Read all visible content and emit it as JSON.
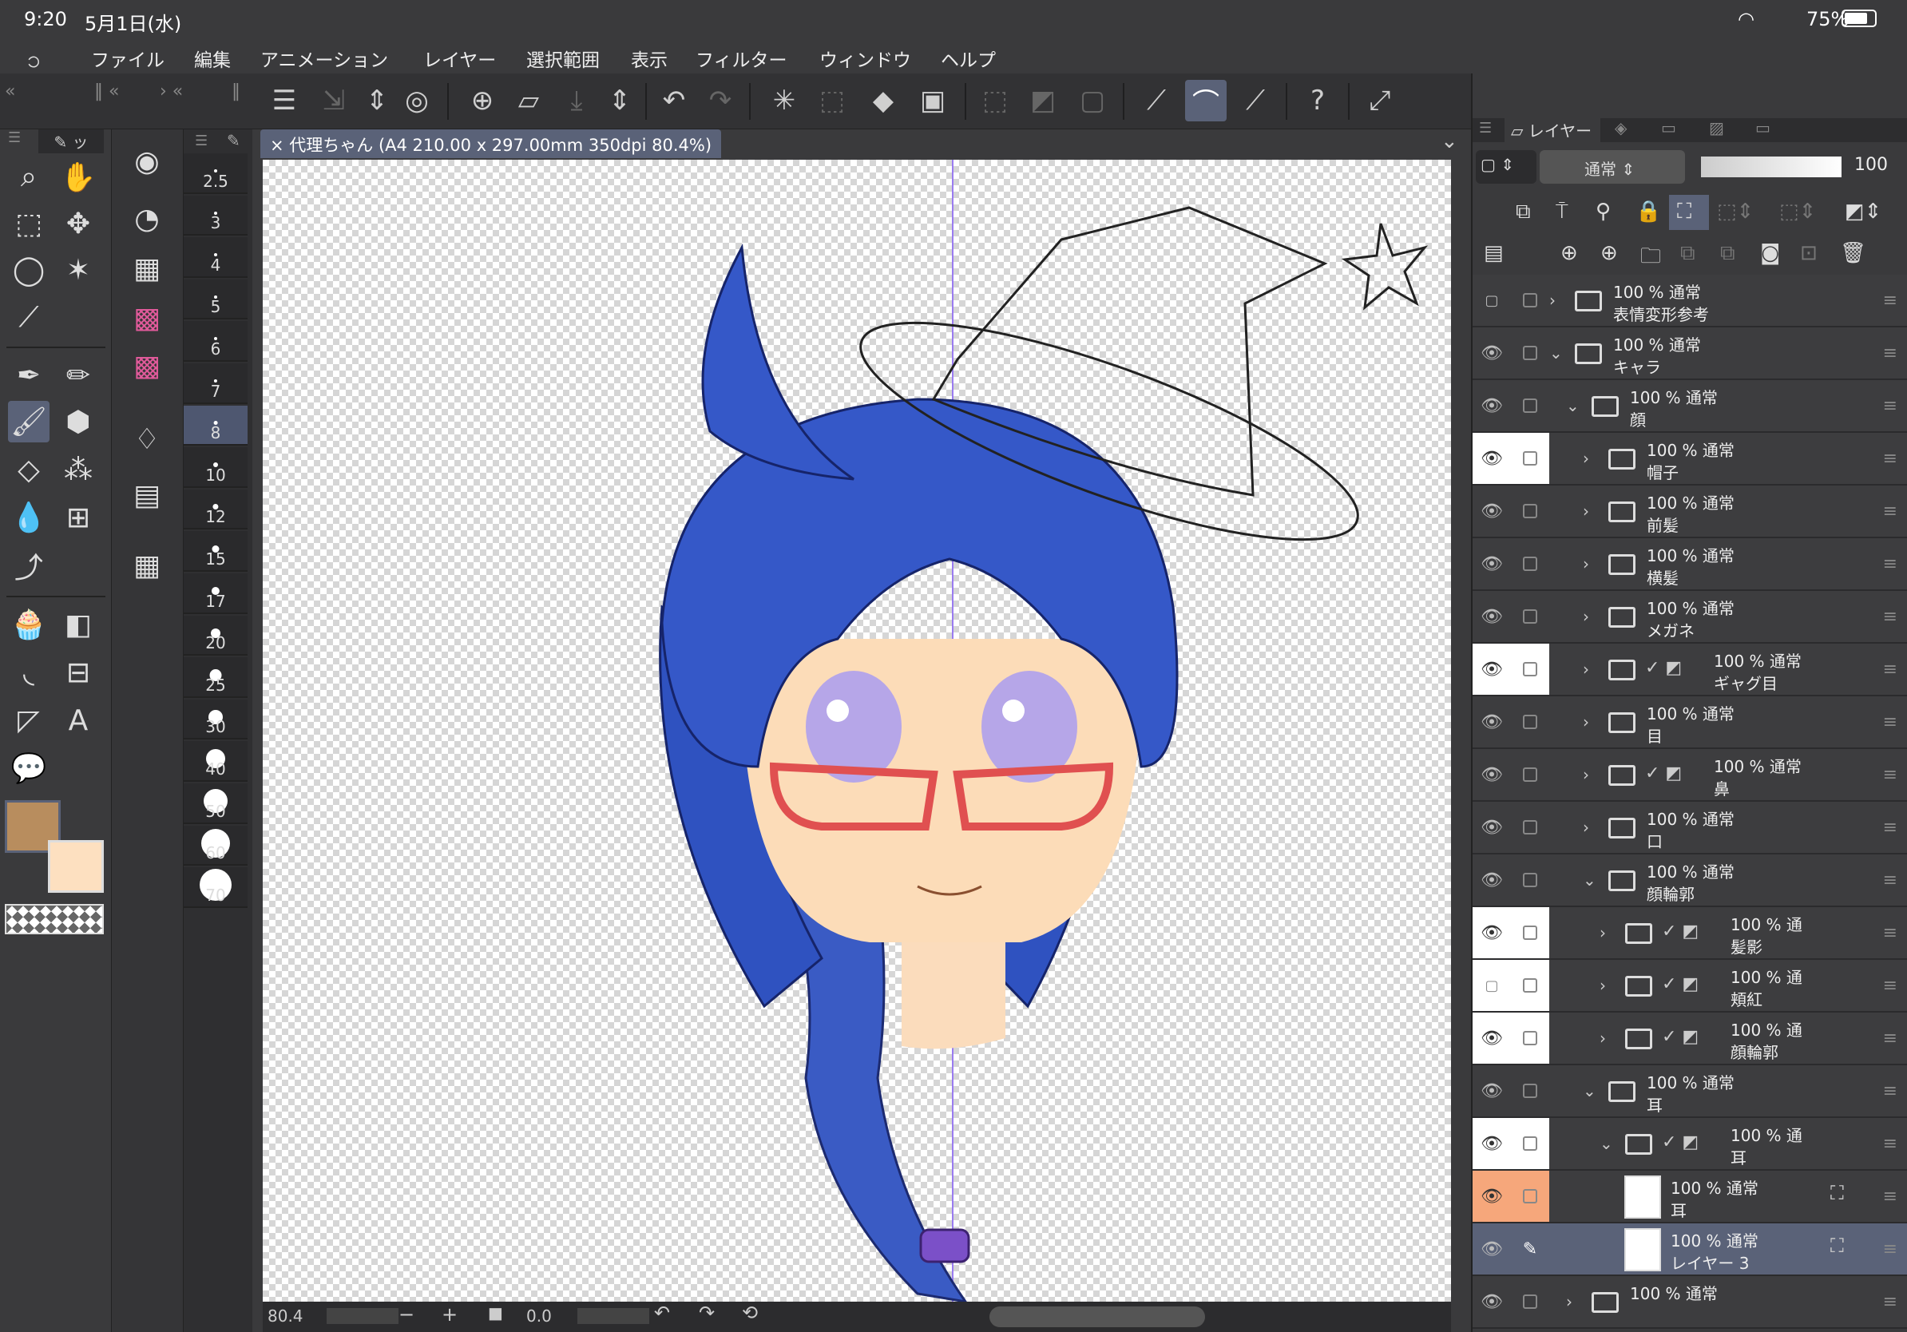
{
  "status": {
    "time": "9:20",
    "date": "5月1日(水)",
    "battery": "75%"
  },
  "menu": [
    "ファイル",
    "編集",
    "アニメーション",
    "レイヤー",
    "選択範囲",
    "表示",
    "フィルター",
    "ウィンドウ",
    "ヘルプ"
  ],
  "document": {
    "tab_label": "代理ちゃん (A4 210.00 x 297.00mm 350dpi 80.4%)"
  },
  "bottom": {
    "zoom": "80.4",
    "angle": "0.0"
  },
  "brush_sizes": [
    "2.5",
    "3",
    "4",
    "5",
    "6",
    "7",
    "8",
    "10",
    "12",
    "15",
    "17",
    "20",
    "25",
    "30",
    "40",
    "50",
    "60",
    "70"
  ],
  "brush_selected": "8",
  "colors": {
    "main": "#b88d5e",
    "sub": "#fde0c0",
    "accent": "#5a6278",
    "highlight": "#f6a77b"
  },
  "layer_panel": {
    "tab_label": "レイヤー",
    "blend_mode": "通常",
    "opacity": "100",
    "layers": [
      {
        "pct": "100 % 通常",
        "name": "表情変形参考",
        "indent": 0,
        "eye": "off",
        "open": false,
        "icon": "folder"
      },
      {
        "pct": "100 % 通常",
        "name": "キャラ",
        "indent": 0,
        "eye": "eye",
        "open": true,
        "icon": "folder"
      },
      {
        "pct": "100 % 通常",
        "name": "顔",
        "indent": 1,
        "eye": "eye",
        "open": true,
        "icon": "folder"
      },
      {
        "pct": "100 % 通常",
        "name": "帽子",
        "indent": 2,
        "eye": "on",
        "open": false,
        "icon": "folder"
      },
      {
        "pct": "100 % 通常",
        "name": "前髪",
        "indent": 2,
        "eye": "eye",
        "open": false,
        "icon": "folder"
      },
      {
        "pct": "100 % 通常",
        "name": "横髪",
        "indent": 2,
        "eye": "eye",
        "open": false,
        "icon": "folder"
      },
      {
        "pct": "100 % 通常",
        "name": "メガネ",
        "indent": 2,
        "eye": "eye",
        "open": false,
        "icon": "folder"
      },
      {
        "pct": "100 % 通常",
        "name": "ギャグ目",
        "indent": 2,
        "eye": "on",
        "open": false,
        "icon": "folder-check"
      },
      {
        "pct": "100 % 通常",
        "name": "目",
        "indent": 2,
        "eye": "eye",
        "open": false,
        "icon": "folder"
      },
      {
        "pct": "100 % 通常",
        "name": "鼻",
        "indent": 2,
        "eye": "eye",
        "open": false,
        "icon": "folder-check"
      },
      {
        "pct": "100 % 通常",
        "name": "口",
        "indent": 2,
        "eye": "eye",
        "open": false,
        "icon": "folder"
      },
      {
        "pct": "100 % 通常",
        "name": "顔輪郭",
        "indent": 2,
        "eye": "eye",
        "open": true,
        "icon": "folder"
      },
      {
        "pct": "100 % 通",
        "name": "髪影",
        "indent": 3,
        "eye": "on",
        "open": false,
        "icon": "folder-check"
      },
      {
        "pct": "100 % 通",
        "name": "頬紅",
        "indent": 3,
        "eye": "blank",
        "open": false,
        "icon": "folder-check"
      },
      {
        "pct": "100 % 通",
        "name": "顔輪郭",
        "indent": 3,
        "eye": "on",
        "open": false,
        "icon": "folder-check"
      },
      {
        "pct": "100 % 通常",
        "name": "耳",
        "indent": 2,
        "eye": "eye",
        "open": true,
        "icon": "folder"
      },
      {
        "pct": "100 % 通",
        "name": "耳",
        "indent": 3,
        "eye": "on",
        "open": true,
        "icon": "folder-check"
      },
      {
        "pct": "100 % 通常",
        "name": "耳",
        "indent": 4,
        "eye": "hl",
        "open": false,
        "icon": "thumb"
      },
      {
        "pct": "100 % 通常",
        "name": "レイヤー 3",
        "indent": 4,
        "eye": "sel",
        "open": false,
        "icon": "thumb"
      },
      {
        "pct": "100 % 通常",
        "name": "",
        "indent": 1,
        "eye": "eye",
        "open": false,
        "icon": "folder"
      }
    ]
  }
}
